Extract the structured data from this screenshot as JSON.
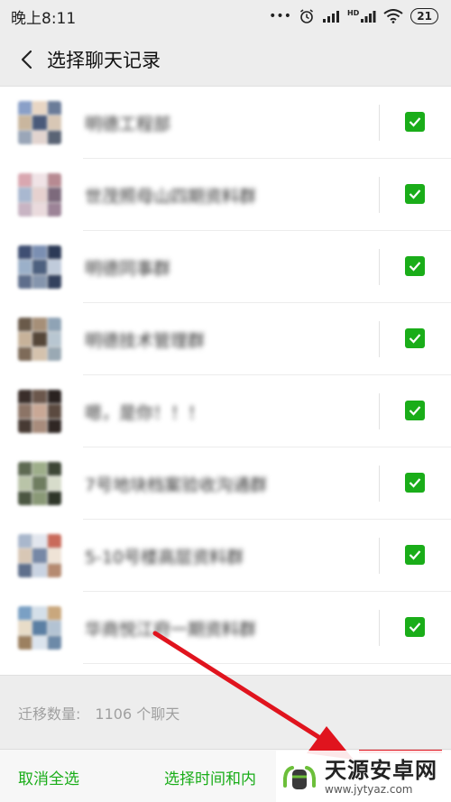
{
  "status_bar": {
    "time": "晚上8:11",
    "dots": "•••",
    "signal_label": "HD",
    "battery": "21"
  },
  "nav": {
    "title": "选择聊天记录"
  },
  "chats": [
    {
      "name": "明德工程部",
      "checked": true
    },
    {
      "name": "世茂照母山四期资料群",
      "checked": true
    },
    {
      "name": "明德同事群",
      "checked": true
    },
    {
      "name": "明德技术管理群",
      "checked": true
    },
    {
      "name": "嗯，是你！！！",
      "checked": true
    },
    {
      "name": "7号地块档案验收沟通群",
      "checked": true
    },
    {
      "name": "5-10号楼高层资料群",
      "checked": true
    },
    {
      "name": "华商悦江府一期资料群",
      "checked": true
    }
  ],
  "summary": {
    "label": "迁移数量:",
    "count": "1106 个聊天"
  },
  "bottom": {
    "deselect_all": "取消全选",
    "select_time": "选择时间和内"
  },
  "watermark": {
    "main": "天源安卓网",
    "sub": "www.jytyaz.com"
  },
  "colors": {
    "accent_green": "#1aad19",
    "arrow_red": "#e0141e"
  }
}
